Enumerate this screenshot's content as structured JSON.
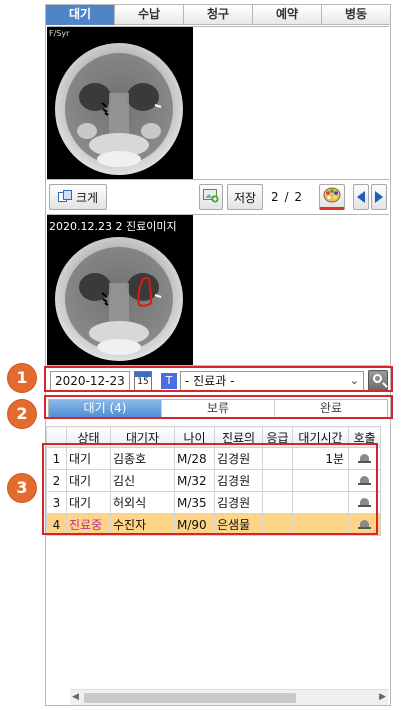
{
  "top_tabs": [
    "대기",
    "수납",
    "청구",
    "예약",
    "병동"
  ],
  "viewer1": {
    "caption": "F/Syr"
  },
  "toolbar": {
    "enlarge_label": "크게",
    "save_label": "저장",
    "page_current": "2",
    "page_total": "2"
  },
  "viewer2": {
    "caption": "2020.12.23 2 진료이미지"
  },
  "filter": {
    "date": "2020-12-23",
    "calendar_day": "15",
    "type_badge": "T",
    "department": "- 진료과 -"
  },
  "status_tabs": [
    "대기 (4)",
    "보류",
    "완료"
  ],
  "table": {
    "columns": [
      "",
      "상태",
      "대기자",
      "나이",
      "진료의",
      "응급",
      "대기시간",
      "호출"
    ],
    "rows": [
      {
        "no": "1",
        "state": "대기",
        "name": "김종호",
        "age": "M/28",
        "doctor": "김경원",
        "emergency": "",
        "wait": "1분"
      },
      {
        "no": "2",
        "state": "대기",
        "name": "김신",
        "age": "M/32",
        "doctor": "김경원",
        "emergency": "",
        "wait": ""
      },
      {
        "no": "3",
        "state": "대기",
        "name": "허외식",
        "age": "M/35",
        "doctor": "김경원",
        "emergency": "",
        "wait": ""
      },
      {
        "no": "4",
        "state": "진료중",
        "name": "수진자",
        "age": "M/90",
        "doctor": "은샘물",
        "emergency": "",
        "wait": ""
      }
    ]
  },
  "callouts": [
    "1",
    "2",
    "3"
  ],
  "colors": {
    "accent": "#4f85c5",
    "highlight_row": "#fed488",
    "callout": "#e36b2f",
    "box": "#d6262c"
  }
}
